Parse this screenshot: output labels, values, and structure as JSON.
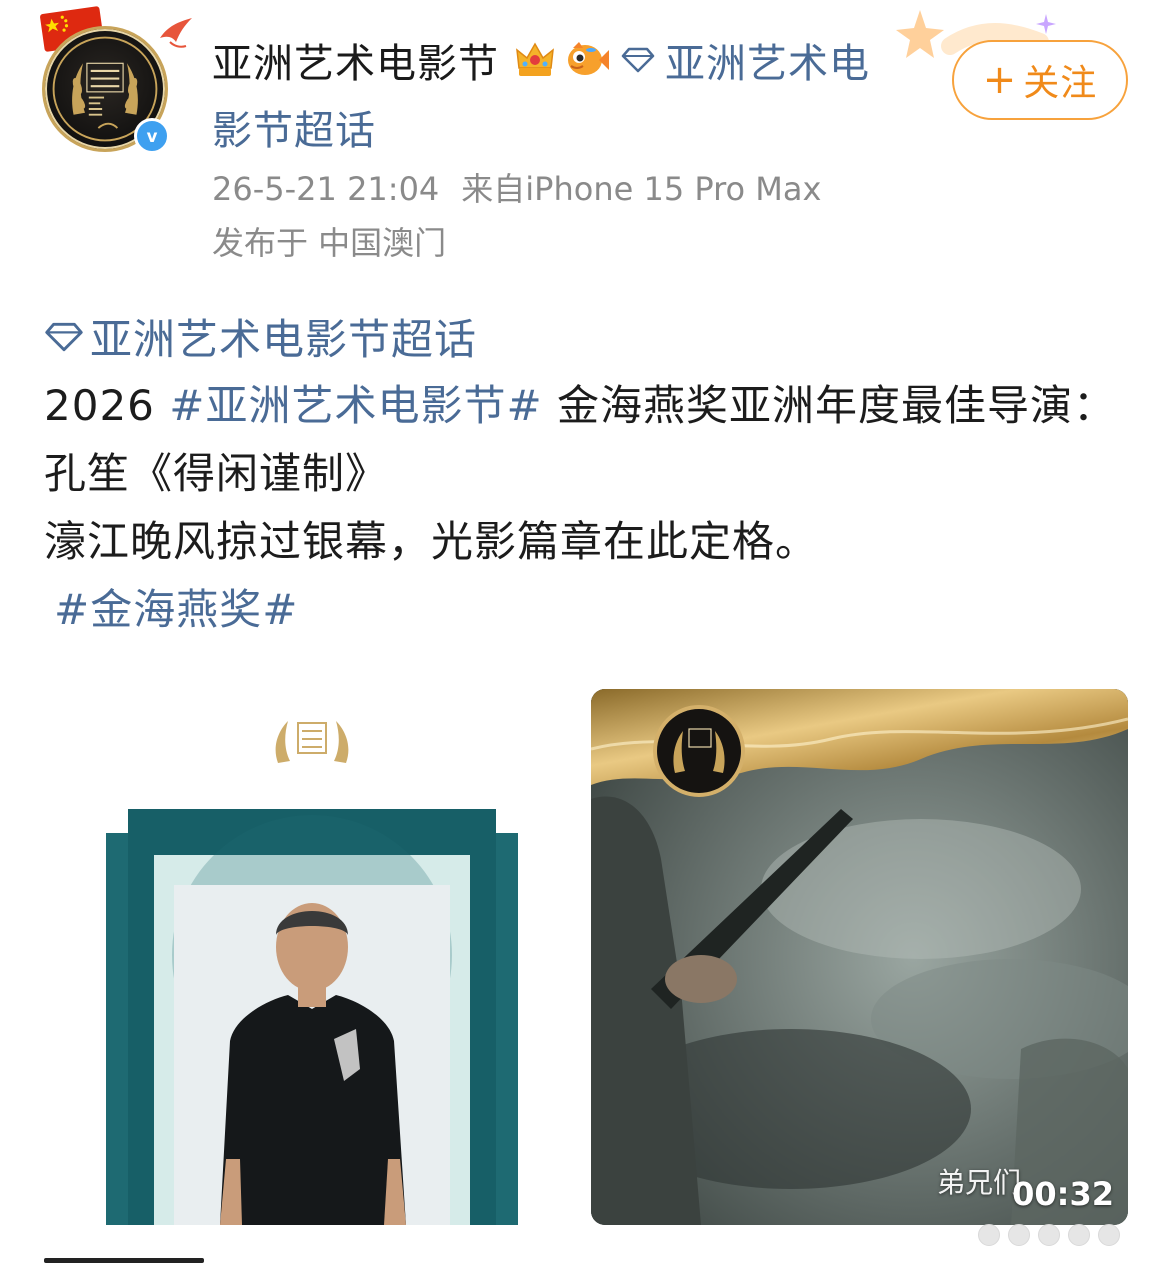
{
  "post": {
    "author": {
      "name": "亚洲艺术电影节",
      "verified": true,
      "badges": [
        "crown-icon",
        "fish-icon"
      ]
    },
    "topic_link": {
      "line1": "亚洲艺术电",
      "line2": "影节超话"
    },
    "meta": {
      "time": "26-5-21 21:04",
      "source": "来自iPhone 15 Pro Max",
      "location": "发布于 中国澳门"
    },
    "follow_button": {
      "plus": "+",
      "label": "关注"
    },
    "super_topic_label": "亚洲艺术电影节超话",
    "content": {
      "year": "2026 ",
      "hashtag1": "#亚洲艺术电影节#",
      "line1_rest": " 金海燕奖亚洲年度最佳导演：孔笙《得闲谨制》",
      "line2": "濠江晚风掠过银幕，光影篇章在此定格。",
      "hashtag2": "#金海燕奖#"
    },
    "media": {
      "video_caption": "弟兄们",
      "video_duration": "00:32"
    }
  },
  "colors": {
    "link": "#4a6b96",
    "follow": "#f08a1a",
    "meta": "#8a8a8a",
    "teal": "#1e6a72",
    "gold": "#c8a45a"
  }
}
